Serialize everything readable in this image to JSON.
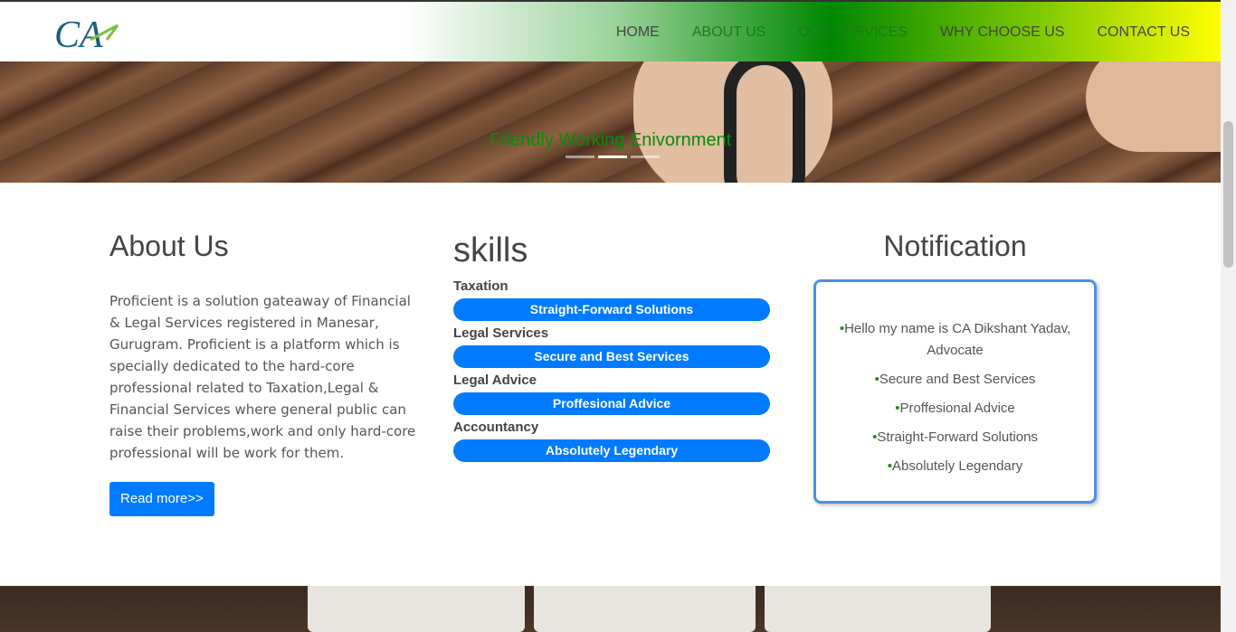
{
  "header": {
    "logo_text": "CA",
    "nav": [
      "HOME",
      "ABOUT US",
      "OUR SERVICES",
      "WHY CHOOSE US",
      "CONTACT US"
    ]
  },
  "hero": {
    "caption": "Friendly Working Enivornment"
  },
  "about": {
    "title": "About Us",
    "body": "Proficient is a solution gateaway of Financial & Legal Services registered in Manesar, Gurugram. Proficient is a platform which is specially dedicated to the hard-core professional related to Taxation,Legal & Financial Services where general public can raise their problems,work and only hard-core professional will be work for them.",
    "button": "Read more>>"
  },
  "skills": {
    "title": "skills",
    "items": [
      {
        "label": "Taxation",
        "bar": "Straight-Forward Solutions"
      },
      {
        "label": "Legal Services",
        "bar": "Secure and Best Services"
      },
      {
        "label": "Legal Advice",
        "bar": "Proffesional Advice"
      },
      {
        "label": "Accountancy",
        "bar": "Absolutely Legendary"
      }
    ]
  },
  "notification": {
    "title": "Notification",
    "items": [
      "Hello my name is CA Dikshant Yadav, Advocate",
      "Secure and Best Services",
      "Proffesional Advice",
      "Straight-Forward Solutions",
      "Absolutely Legendary"
    ]
  },
  "colors": {
    "accent": "#007bff",
    "caption": "#0a8a0a",
    "bullet": "#1a8a1a"
  }
}
